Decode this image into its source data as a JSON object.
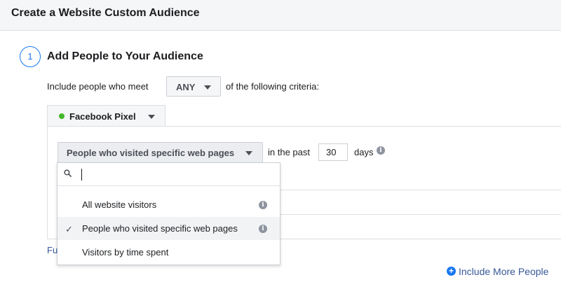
{
  "header": {
    "title": "Create a Website Custom Audience"
  },
  "step": {
    "number": "1",
    "title": "Add People to Your Audience"
  },
  "criteria": {
    "prefix": "Include people who meet",
    "match_value": "ANY",
    "suffix": "of the following criteria:"
  },
  "source": {
    "label": "Facebook Pixel",
    "status_color": "#42b72a"
  },
  "rule": {
    "selected": "People who visited specific web pages",
    "in_the_past": "in the past",
    "days_value": "30",
    "days_label": "days"
  },
  "menu": {
    "search_value": "",
    "items": [
      {
        "label": "All website visitors",
        "checked": false,
        "info": true
      },
      {
        "label": "People who visited specific web pages",
        "checked": true,
        "info": true
      },
      {
        "label": "Visitors by time spent",
        "checked": false,
        "info": false
      }
    ]
  },
  "footer": {
    "partial_link": "Fu",
    "include_more": "Include More People"
  },
  "colors": {
    "accent": "#1877f2",
    "link": "#385898"
  }
}
